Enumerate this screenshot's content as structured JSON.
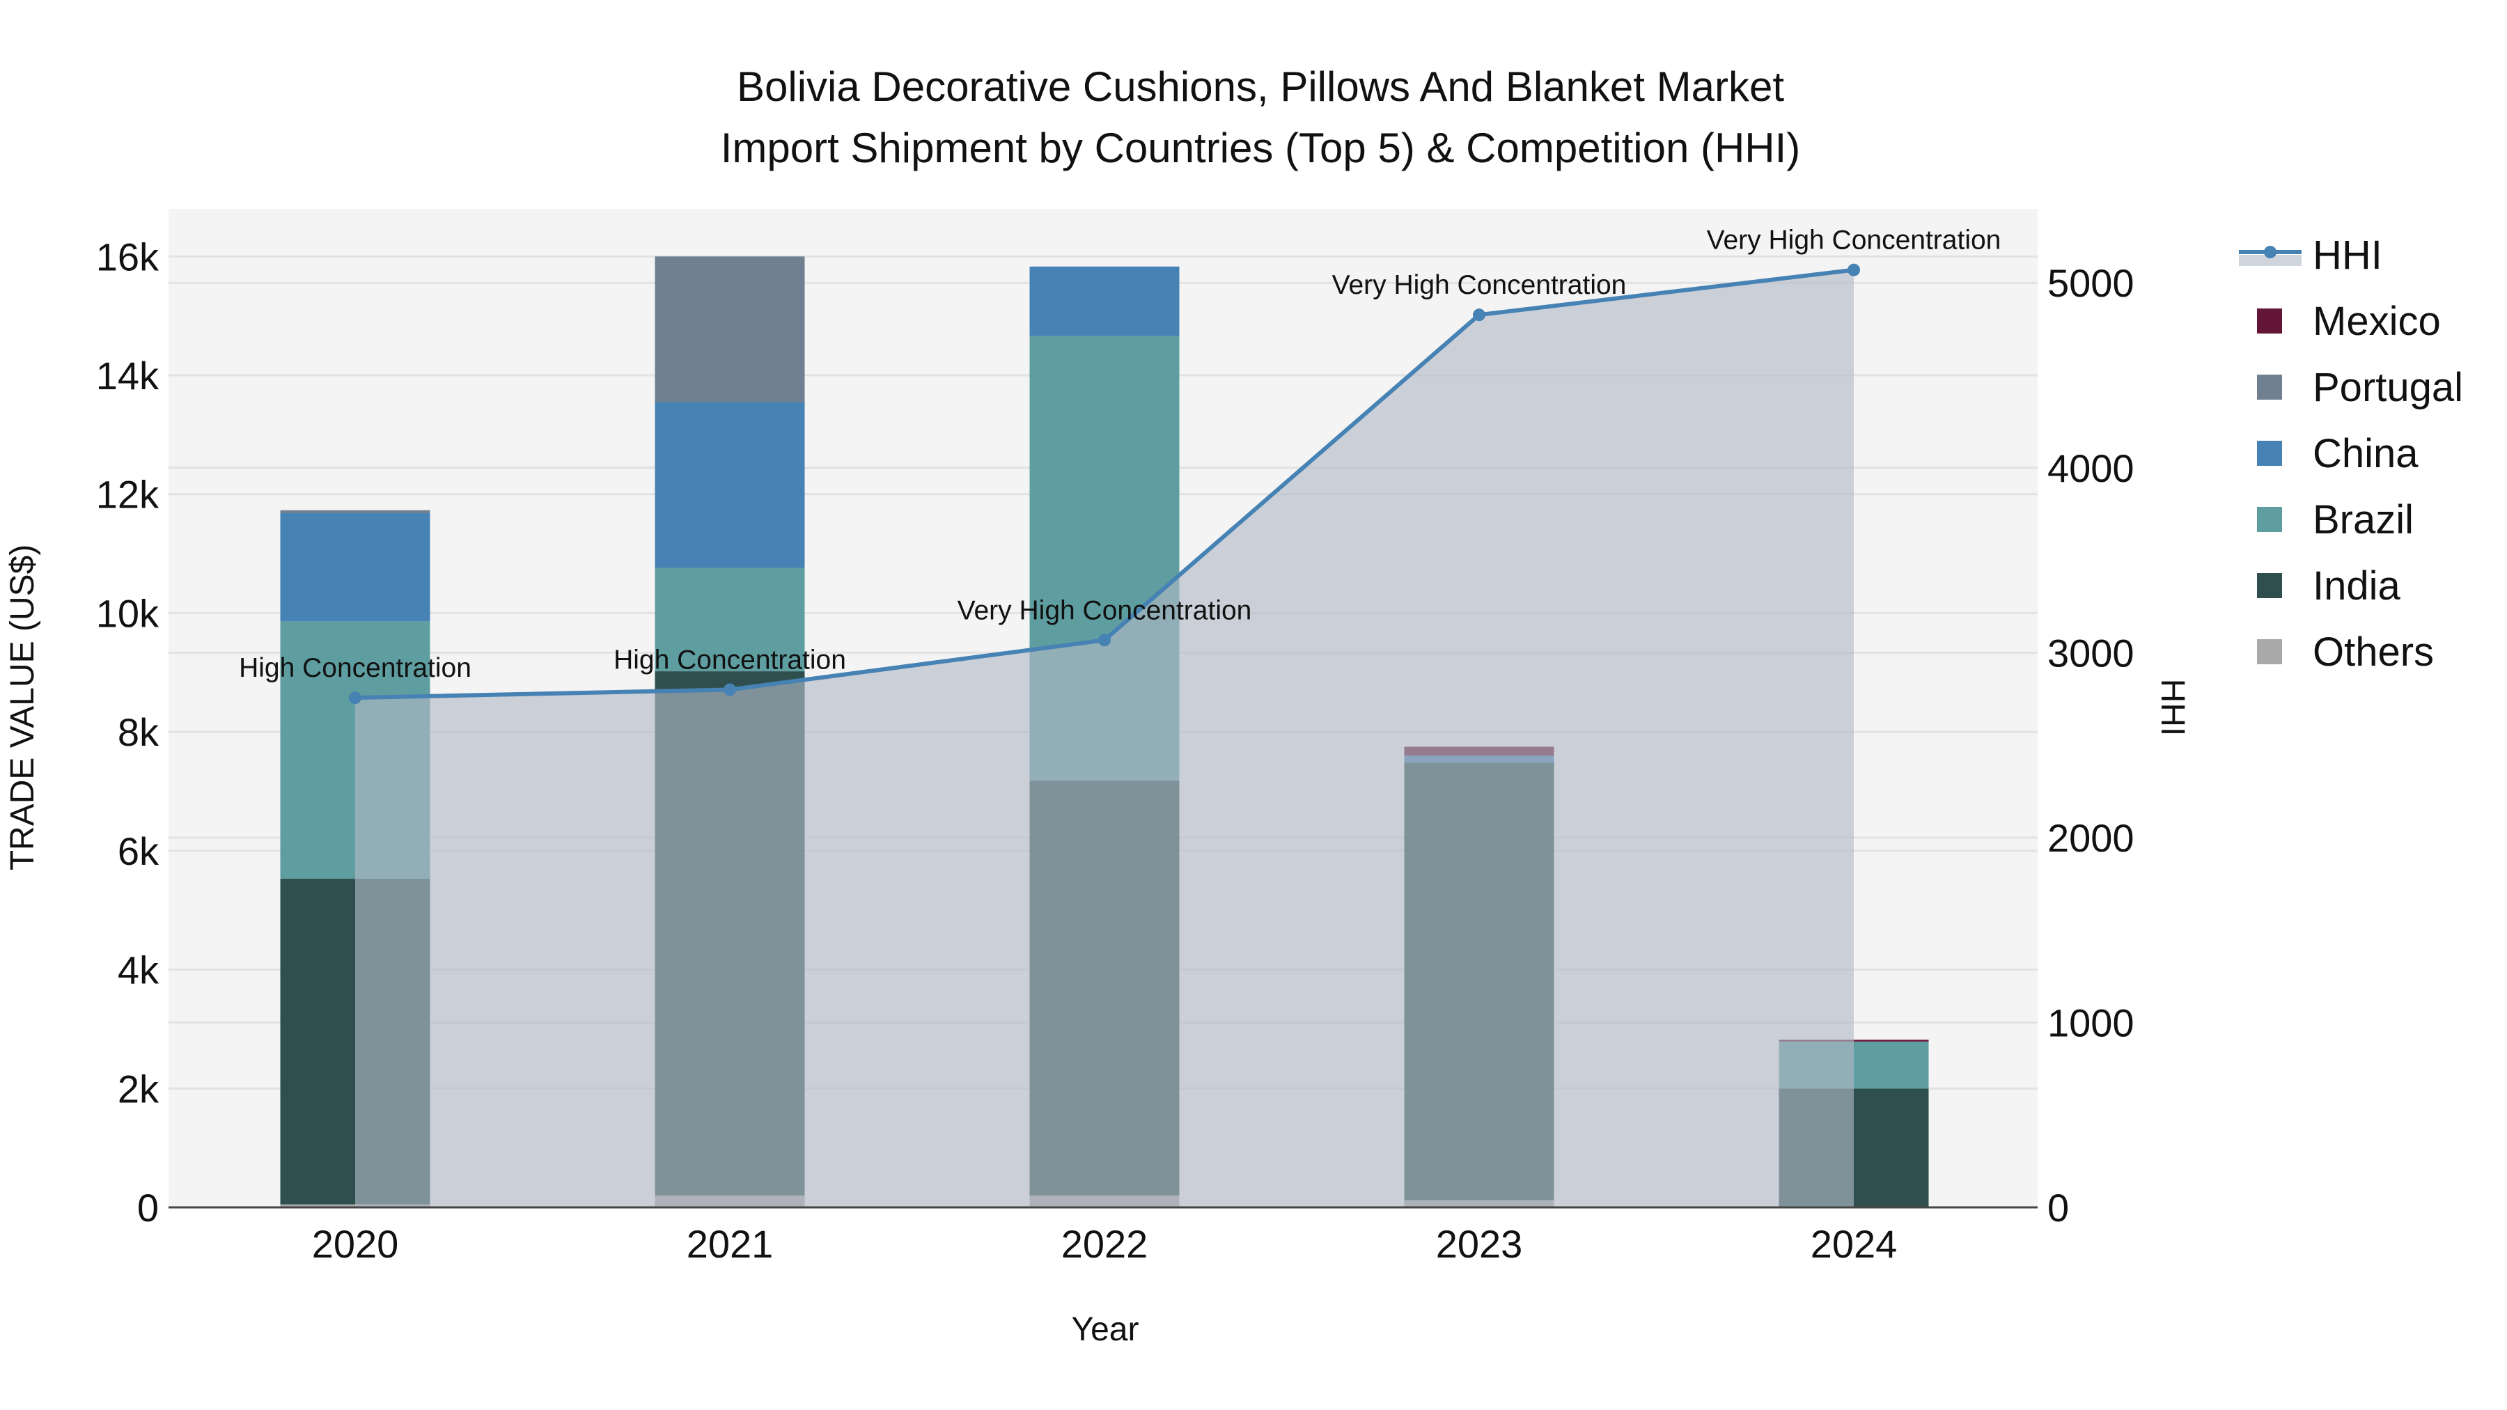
{
  "chart_data": {
    "type": "bar",
    "title_line1": "Bolivia Decorative Cushions, Pillows And Blanket Market",
    "title_line2": "Import Shipment by Countries (Top 5) & Competition (HHI)",
    "xlabel": "Year",
    "ylabel": "TRADE VALUE (US$)",
    "y2label": "HHI",
    "categories": [
      "2020",
      "2021",
      "2022",
      "2023",
      "2024"
    ],
    "ylim": [
      0,
      16800
    ],
    "yticks": [
      0,
      2000,
      4000,
      6000,
      8000,
      10000,
      12000,
      14000,
      16000
    ],
    "ytick_labels": [
      "0",
      "2k",
      "4k",
      "6k",
      "8k",
      "10k",
      "12k",
      "14k",
      "16k"
    ],
    "y2lim": [
      0,
      5400
    ],
    "y2ticks": [
      0,
      1000,
      2000,
      3000,
      4000,
      5000
    ],
    "y2tick_labels": [
      "0",
      "1000",
      "2000",
      "3000",
      "4000",
      "5000"
    ],
    "grid": true,
    "legend_position": "right",
    "series": [
      {
        "name": "Others",
        "color": "#A9A9A9",
        "values": [
          50,
          200,
          200,
          120,
          0
        ]
      },
      {
        "name": "India",
        "color": "#2F4F4F",
        "values": [
          5480,
          8820,
          6980,
          7360,
          2000
        ]
      },
      {
        "name": "Brazil",
        "color": "#5F9EA0",
        "values": [
          4330,
          1740,
          7480,
          0,
          790
        ]
      },
      {
        "name": "China",
        "color": "#4682B4",
        "values": [
          1820,
          2790,
          1170,
          120,
          0
        ]
      },
      {
        "name": "Portugal",
        "color": "#708090",
        "values": [
          50,
          2450,
          0,
          0,
          0
        ]
      },
      {
        "name": "Mexico",
        "color": "#641636",
        "values": [
          0,
          0,
          0,
          150,
          30
        ]
      }
    ],
    "hhi": {
      "name": "HHI",
      "color": "#4682B4",
      "values": [
        2756,
        2800,
        3068,
        4827,
        5070
      ],
      "annotations": [
        "High Concentration",
        "High Concentration",
        "Very High Concentration",
        "Very High Concentration",
        "Very High Concentration"
      ]
    },
    "legend_order": [
      "HHI",
      "Mexico",
      "Portugal",
      "China",
      "Brazil",
      "India",
      "Others"
    ]
  }
}
